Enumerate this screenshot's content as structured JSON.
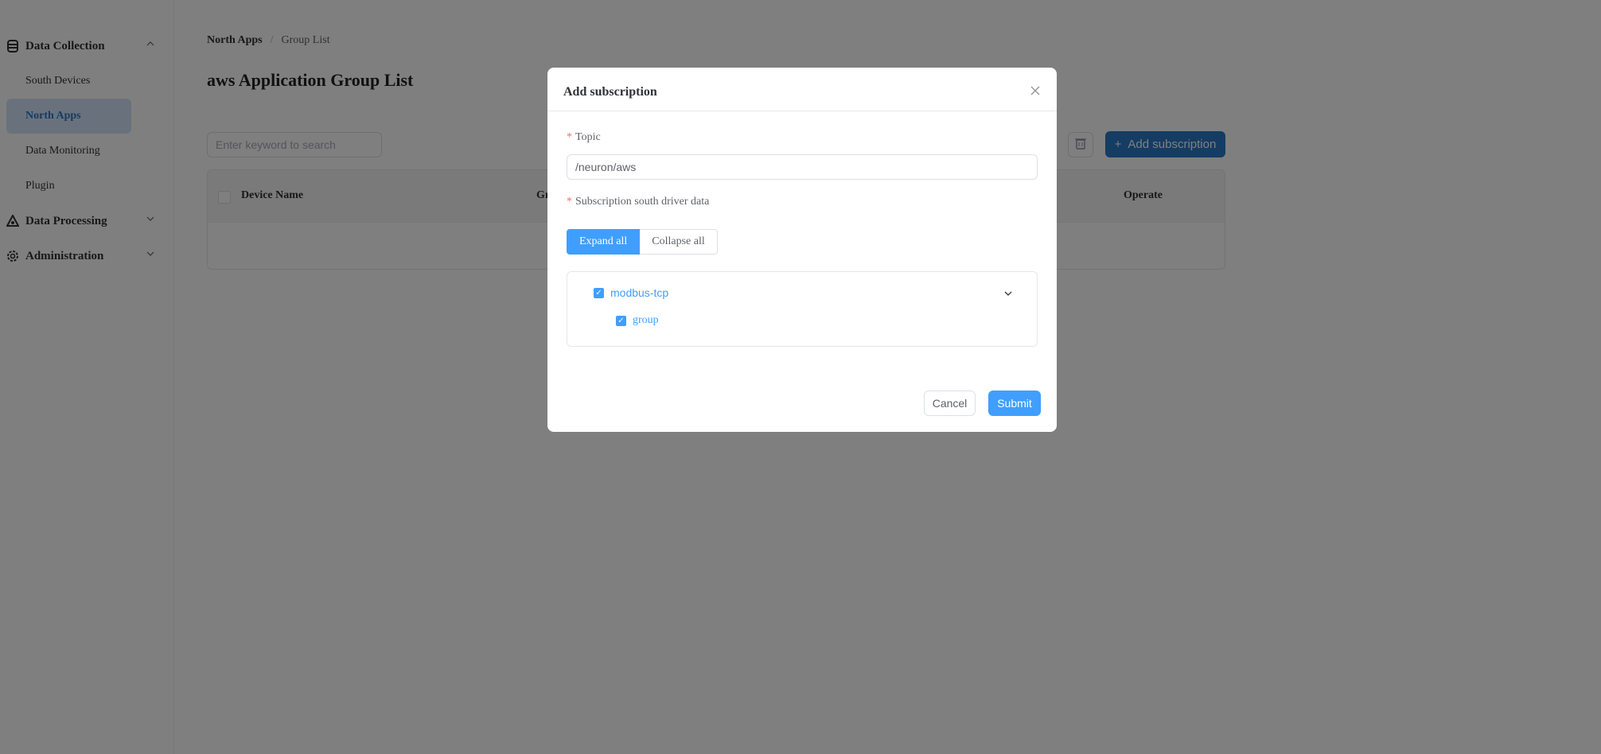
{
  "sidebar": {
    "groups": [
      {
        "label": "Data Collection",
        "icon": "database-icon",
        "expanded": true,
        "items": [
          {
            "label": "South Devices",
            "active": false
          },
          {
            "label": "North Apps",
            "active": true
          },
          {
            "label": "Data Monitoring",
            "active": false
          },
          {
            "label": "Plugin",
            "active": false
          }
        ]
      },
      {
        "label": "Data Processing",
        "icon": "processing-icon",
        "expanded": false
      },
      {
        "label": "Administration",
        "icon": "gear-icon",
        "expanded": false
      }
    ]
  },
  "breadcrumb": {
    "parent": "North Apps",
    "separator": "/",
    "current": "Group List"
  },
  "page": {
    "title": "aws Application Group List",
    "search_placeholder": "Enter keyword to search",
    "add_button": "Add subscription",
    "table": {
      "columns": [
        "Device Name",
        "Group Name",
        "Operate"
      ],
      "rows": []
    }
  },
  "modal": {
    "title": "Add subscription",
    "topic_label": "Topic",
    "topic_value": "/neuron/aws",
    "subscription_label": "Subscription south driver data",
    "expand_all": "Expand all",
    "collapse_all": "Collapse all",
    "tree": [
      {
        "label": "modbus-tcp",
        "checked": true,
        "children": [
          {
            "label": "group",
            "checked": true
          }
        ]
      }
    ],
    "cancel": "Cancel",
    "submit": "Submit"
  },
  "colors": {
    "primary": "#409eff",
    "brand": "#2b78c7",
    "required": "#f56c6c"
  }
}
